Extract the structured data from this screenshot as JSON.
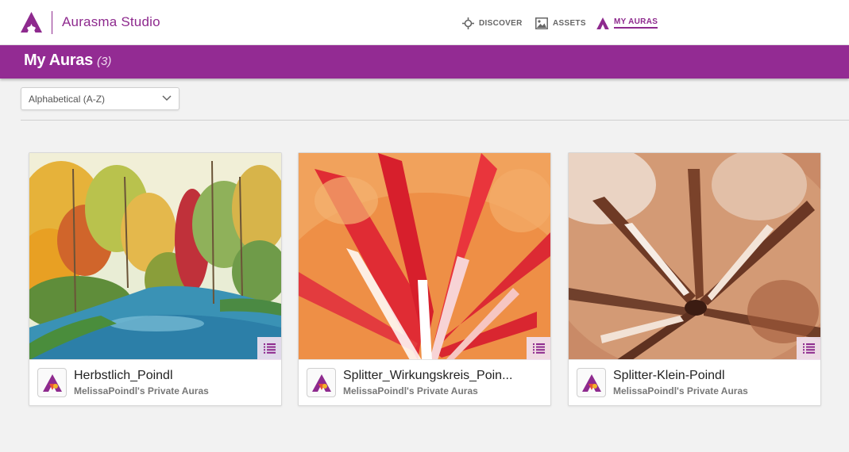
{
  "app": {
    "name": "Aurasma Studio",
    "brand_color": "#8e2a8e",
    "header_color": "#932b93"
  },
  "nav": {
    "items": [
      {
        "label": "DISCOVER",
        "icon": "crosshair-icon",
        "active": false
      },
      {
        "label": "ASSETS",
        "icon": "image-icon",
        "active": false
      },
      {
        "label": "MY AURAS",
        "icon": "aurasma-logo-icon",
        "active": true
      }
    ]
  },
  "page": {
    "title": "My Auras",
    "count": "(3)"
  },
  "sort": {
    "selected": "Alphabetical (A-Z)",
    "icon": "chevron-down-icon"
  },
  "auras": [
    {
      "title": "Herbstlich_Poindl",
      "owner": "MelissaPoindl's Private Auras",
      "menu_icon": "list-icon"
    },
    {
      "title": "Splitter_Wirkungskreis_Poin...",
      "owner": "MelissaPoindl's Private Auras",
      "menu_icon": "list-icon"
    },
    {
      "title": "Splitter-Klein-Poindl",
      "owner": "MelissaPoindl's Private Auras",
      "menu_icon": "list-icon"
    }
  ]
}
